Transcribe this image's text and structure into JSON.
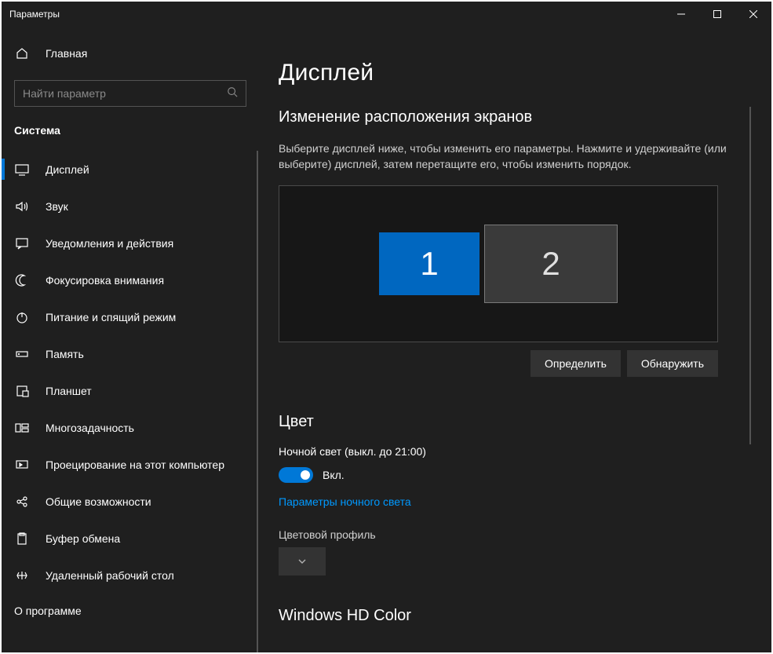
{
  "titlebar": {
    "title": "Параметры"
  },
  "sidebar": {
    "home": "Главная",
    "search_placeholder": "Найти параметр",
    "category": "Система",
    "items": [
      {
        "label": "Дисплей",
        "icon": "display"
      },
      {
        "label": "Звук",
        "icon": "sound"
      },
      {
        "label": "Уведомления и действия",
        "icon": "notifications"
      },
      {
        "label": "Фокусировка внимания",
        "icon": "focus"
      },
      {
        "label": "Питание и спящий режим",
        "icon": "power"
      },
      {
        "label": "Память",
        "icon": "storage"
      },
      {
        "label": "Планшет",
        "icon": "tablet"
      },
      {
        "label": "Многозадачность",
        "icon": "multitask"
      },
      {
        "label": "Проецирование на этот компьютер",
        "icon": "project"
      },
      {
        "label": "Общие возможности",
        "icon": "shared"
      },
      {
        "label": "Буфер обмена",
        "icon": "clipboard"
      },
      {
        "label": "Удаленный рабочий стол",
        "icon": "remote"
      }
    ],
    "last_partial": "О программе"
  },
  "page": {
    "title": "Дисплей",
    "arrange_heading": "Изменение расположения экранов",
    "arrange_instruction": "Выберите дисплей ниже, чтобы изменить его параметры. Нажмите и удерживайте (или выберите) дисплей, затем перетащите его, чтобы изменить порядок.",
    "monitor1": "1",
    "monitor2": "2",
    "identify_btn": "Определить",
    "detect_btn": "Обнаружить",
    "color_heading": "Цвет",
    "night_light_label": "Ночной свет (выкл. до 21:00)",
    "toggle_state": "Вкл.",
    "night_light_link": "Параметры ночного света",
    "color_profile_label": "Цветовой профиль",
    "hd_color_heading": "Windows HD Color"
  }
}
